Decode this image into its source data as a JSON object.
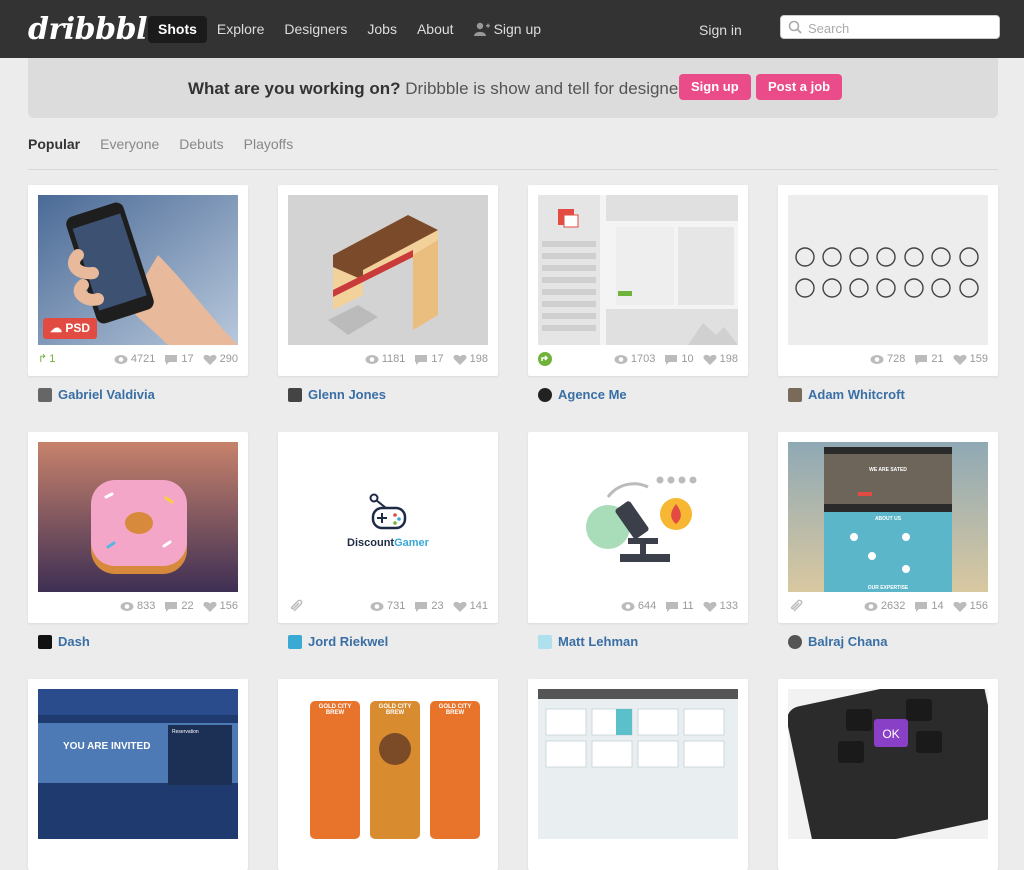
{
  "brand": {
    "logo": "dribbble"
  },
  "nav": {
    "items": [
      "Shots",
      "Explore",
      "Designers",
      "Jobs",
      "About"
    ],
    "signup": "Sign up",
    "signin": "Sign in",
    "search_placeholder": "Search"
  },
  "banner": {
    "question": "What are you working on?",
    "tagline": "Dribbble is show and tell for designers.",
    "signup_btn": "Sign up",
    "post_job_btn": "Post a job"
  },
  "filters": [
    "Popular",
    "Everyone",
    "Debuts",
    "Playoffs"
  ],
  "shots": [
    {
      "author": "Gabriel Valdivia",
      "views": "4721",
      "comments": "17",
      "likes": "290",
      "rebounds": "1",
      "badge": "PSD"
    },
    {
      "author": "Glenn Jones",
      "views": "1181",
      "comments": "17",
      "likes": "198"
    },
    {
      "author": "Agence Me",
      "views": "1703",
      "comments": "10",
      "likes": "198"
    },
    {
      "author": "Adam Whitcroft",
      "views": "728",
      "comments": "21",
      "likes": "159"
    },
    {
      "author": "Dash",
      "views": "833",
      "comments": "22",
      "likes": "156"
    },
    {
      "author": "Jord Riekwel",
      "views": "731",
      "comments": "23",
      "likes": "141",
      "logo_a": "Discount",
      "logo_b": "Gamer"
    },
    {
      "author": "Matt Lehman",
      "views": "644",
      "comments": "11",
      "likes": "133"
    },
    {
      "author": "Balraj Chana",
      "views": "2632",
      "comments": "14",
      "likes": "156",
      "mock_title": "WE ARE SATED",
      "mock_about": "ABOUT US",
      "mock_expertise": "OUR EXPERTISE"
    },
    {
      "invite_text": "YOU ARE INVITED",
      "reservation": "Reservation"
    },
    {
      "can_label": "GOLD CITY BREW"
    },
    {},
    {
      "ok_label": "OK"
    }
  ],
  "colors": {
    "pink": "#ea4c89",
    "link": "#3a6fa5",
    "rebound": "#6fb33b",
    "topbar": "#333333"
  }
}
